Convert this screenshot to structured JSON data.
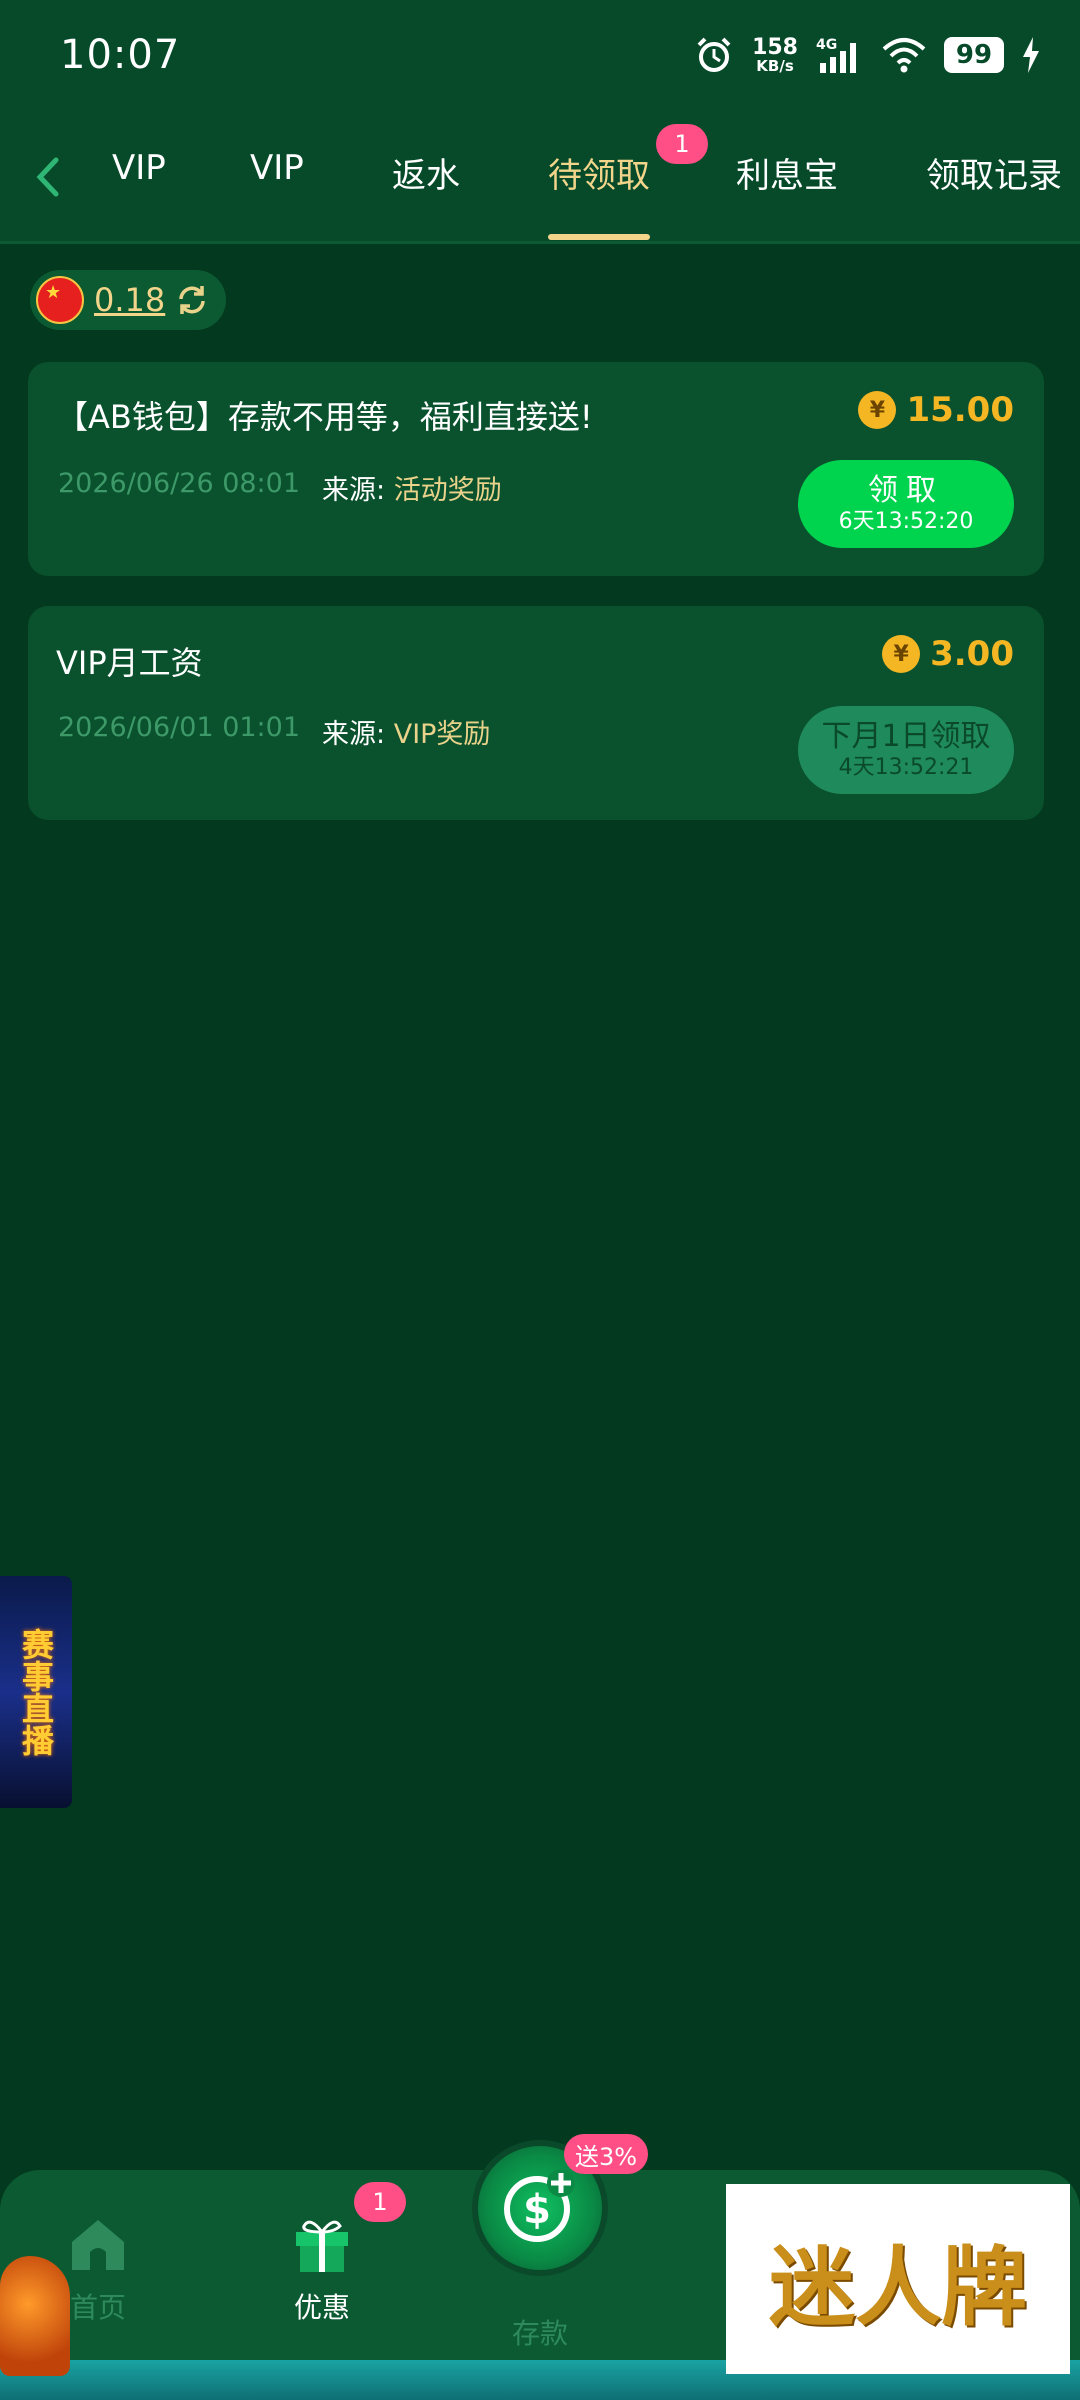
{
  "status_bar": {
    "time": "10:07",
    "net_speed_value": "158",
    "net_speed_unit": "KB/s",
    "network": "4G",
    "battery": "99"
  },
  "tabs": [
    {
      "label": "VIP"
    },
    {
      "label": "VIP"
    },
    {
      "label": "返水"
    },
    {
      "label": "待领取",
      "active": true,
      "badge": "1"
    },
    {
      "label": "利息宝"
    },
    {
      "label": "领取记录"
    }
  ],
  "balance": {
    "value": "0.18"
  },
  "rewards": [
    {
      "title": "【AB钱包】存款不用等，福利直接送!",
      "amount": "15.00",
      "date": "2026/06/26 08:01",
      "source_label": "来源:",
      "source_value": "活动奖励",
      "button_label": "领取",
      "button_countdown": "6天13:52:20",
      "button_state": "active"
    },
    {
      "title": "VIP月工资",
      "amount": "3.00",
      "date": "2026/06/01 01:01",
      "source_label": "来源:",
      "source_value": "VIP奖励",
      "button_label": "下月1日领取",
      "button_countdown": "4天13:52:21",
      "button_state": "disabled"
    }
  ],
  "side_banner": {
    "text": "赛事直播"
  },
  "bottom_nav": {
    "home_label": "首页",
    "promo_label": "优惠",
    "promo_badge": "1",
    "deposit_label": "存款",
    "deposit_badge": "送3%"
  },
  "watermark": {
    "text": "迷人牌"
  },
  "colors": {
    "background": "#03391f",
    "accent_gold": "#f2d58b",
    "amount_gold": "#f5b623",
    "claim_green": "#00d44e",
    "badge_pink": "#ff4f86"
  }
}
